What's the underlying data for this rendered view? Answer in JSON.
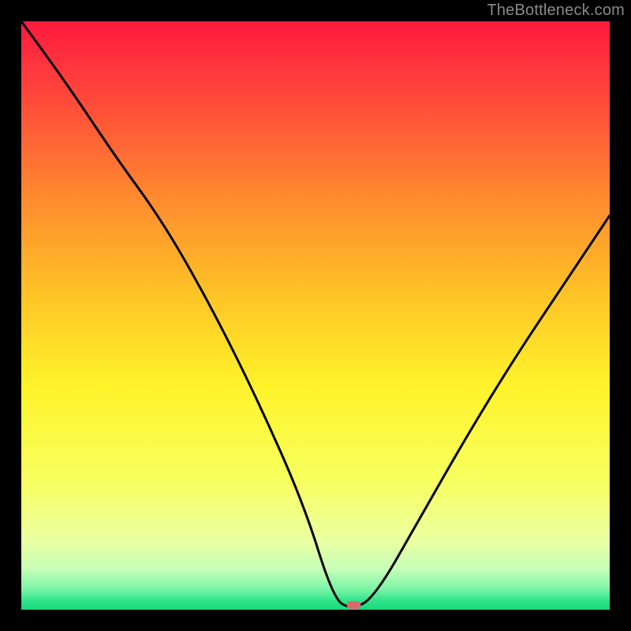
{
  "watermark": "TheBottleneck.com",
  "chart_data": {
    "type": "line",
    "title": "",
    "xlabel": "",
    "ylabel": "",
    "xlim": [
      0,
      100
    ],
    "ylim": [
      0,
      100
    ],
    "x": [
      0,
      8,
      16,
      24,
      32,
      40,
      48,
      53,
      56,
      60,
      68,
      76,
      84,
      92,
      100
    ],
    "values": [
      100,
      89,
      77,
      66,
      52,
      36,
      18,
      2,
      0,
      2,
      16,
      30,
      43,
      55,
      67
    ],
    "marker": {
      "x": 56.5,
      "y": 0.8,
      "color": "#d96a6a"
    },
    "background_gradient": {
      "stops": [
        {
          "offset": 0.0,
          "color": "#ff1a3f"
        },
        {
          "offset": 0.14,
          "color": "#ff4c3a"
        },
        {
          "offset": 0.3,
          "color": "#ff8a2f"
        },
        {
          "offset": 0.46,
          "color": "#ffc226"
        },
        {
          "offset": 0.62,
          "color": "#fff32a"
        },
        {
          "offset": 0.78,
          "color": "#f7ff5e"
        },
        {
          "offset": 0.88,
          "color": "#ecffa0"
        },
        {
          "offset": 0.93,
          "color": "#c7ffb8"
        },
        {
          "offset": 0.965,
          "color": "#7bf5a6"
        },
        {
          "offset": 0.985,
          "color": "#2ee48b"
        },
        {
          "offset": 1.0,
          "color": "#18d97a"
        }
      ]
    },
    "line_color": "#000000",
    "marker_visible": true
  }
}
